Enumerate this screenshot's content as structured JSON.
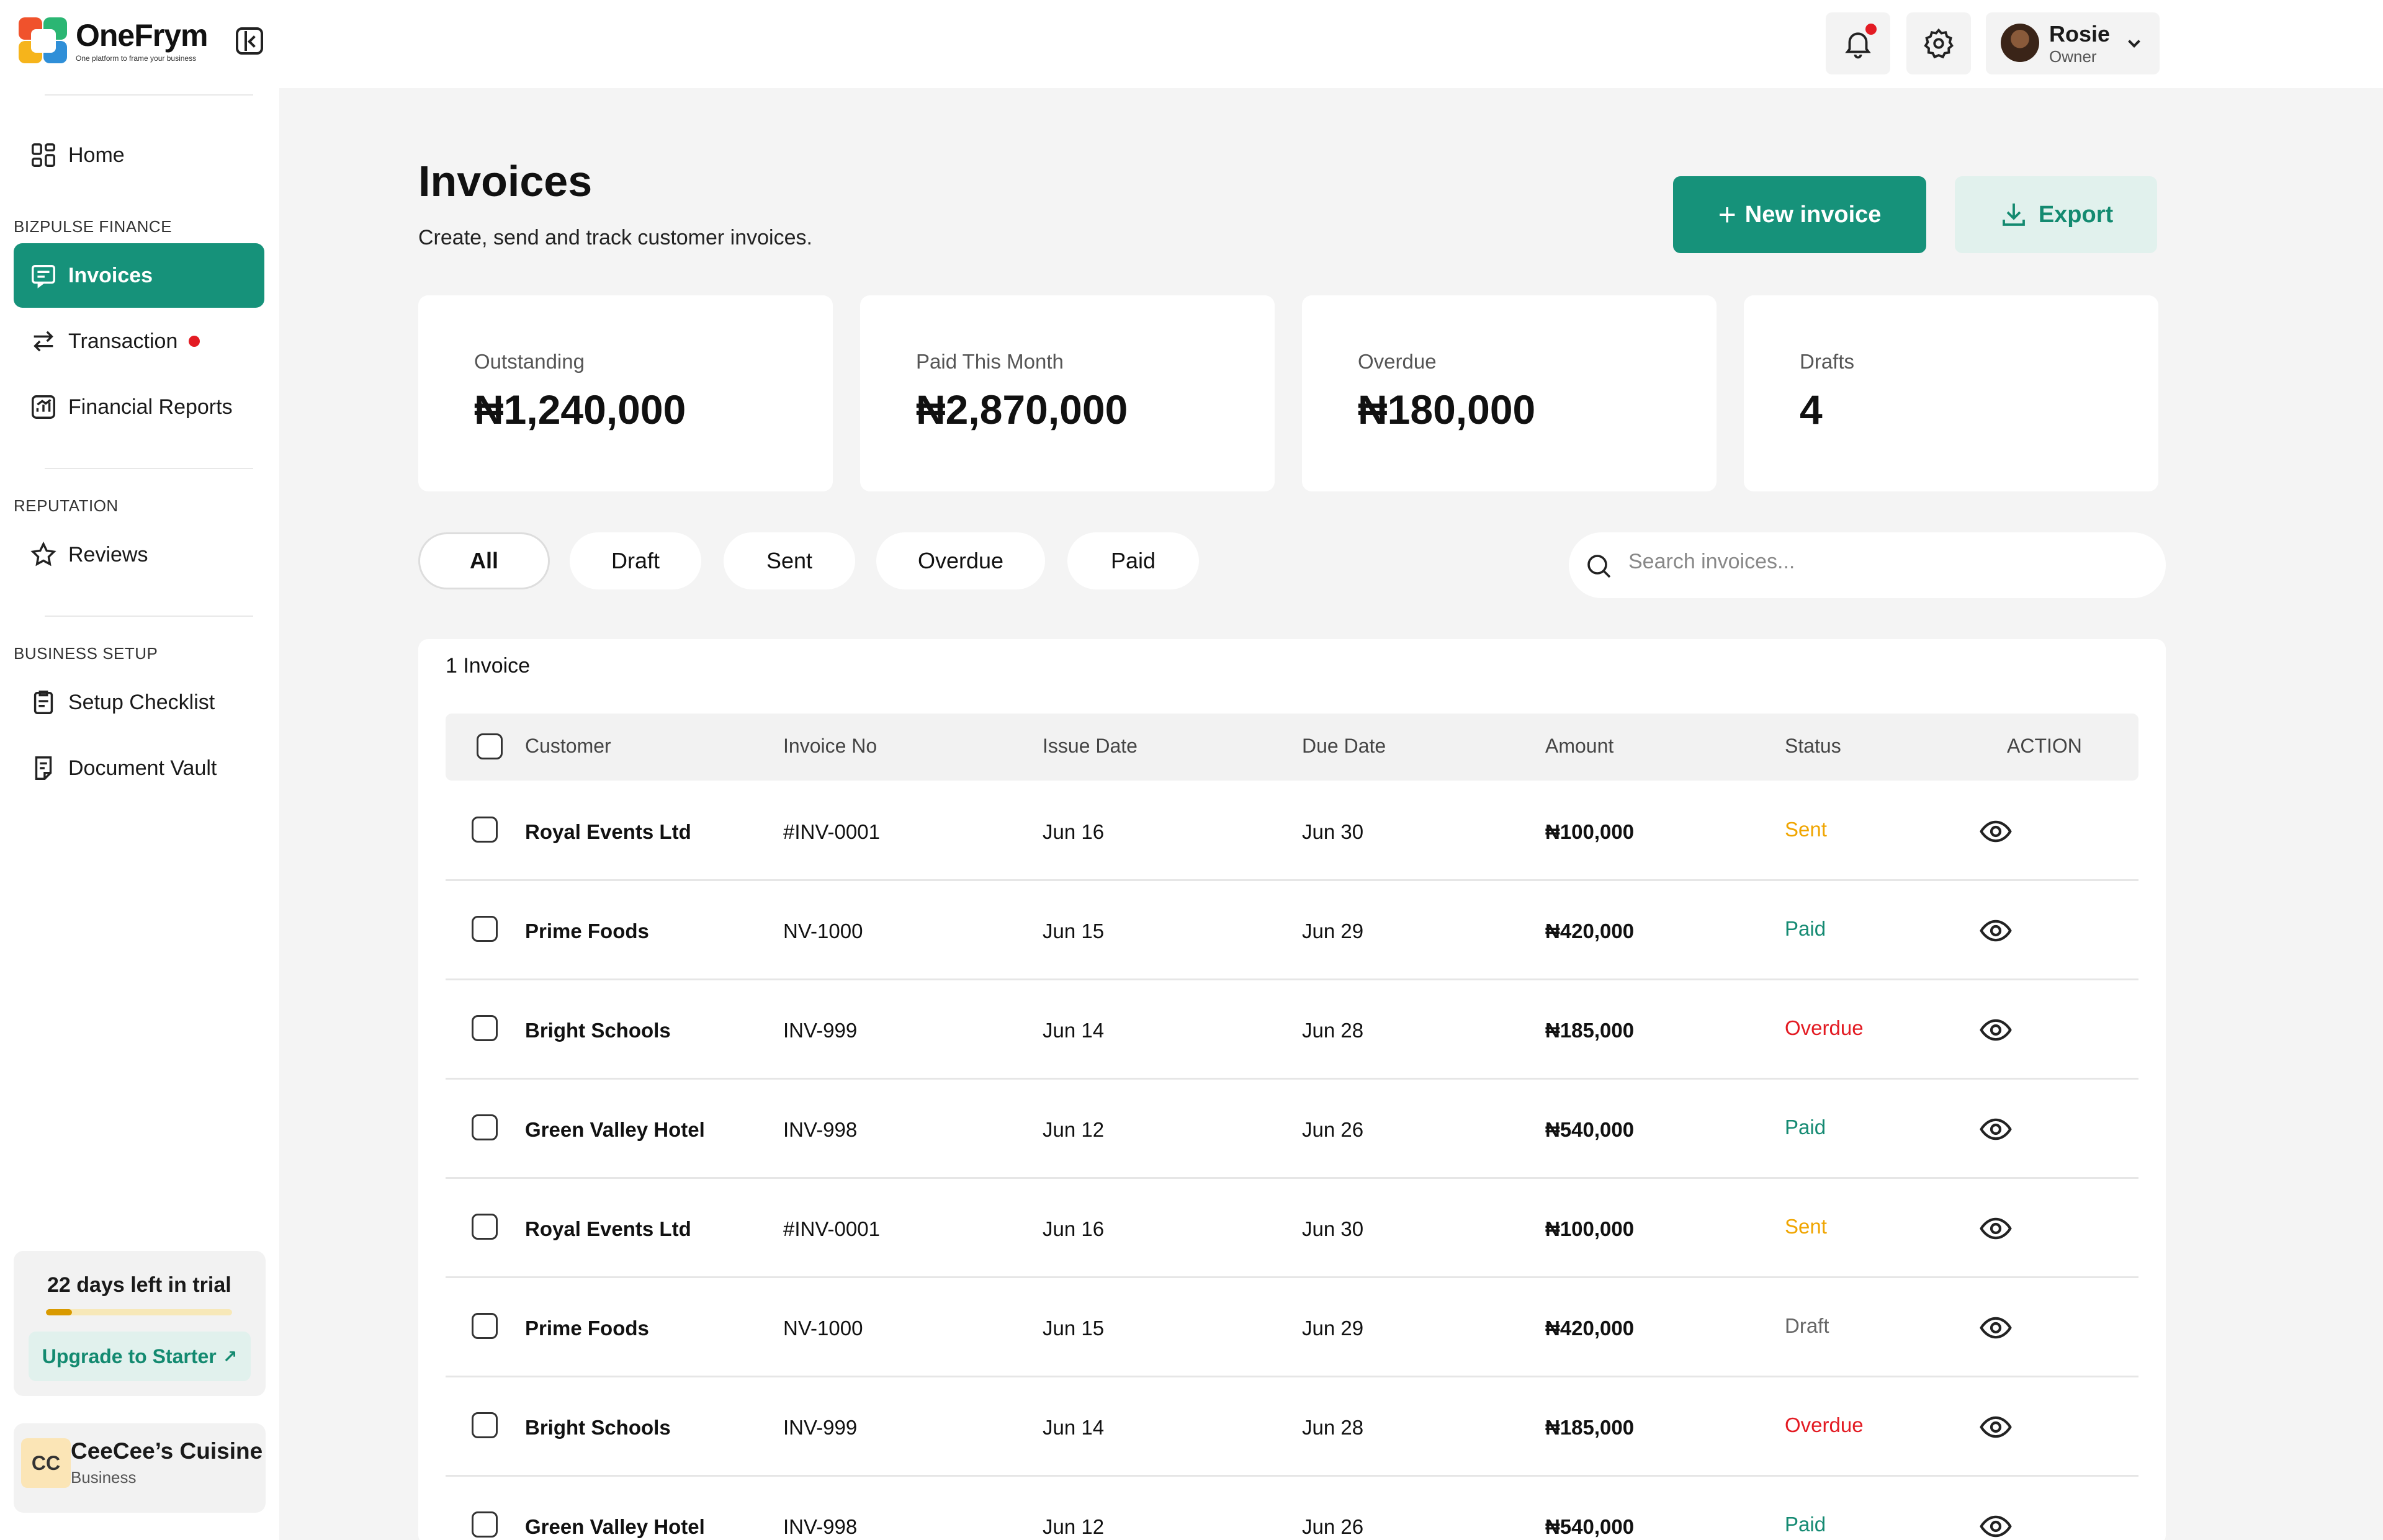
{
  "brand": {
    "name": "OneFrym",
    "tagline": "One platform to frame your business"
  },
  "sidebar": {
    "home": "Home",
    "sections": [
      {
        "label": "BIZPULSE FINANCE",
        "items": [
          "Invoices",
          "Transaction",
          "Financial Reports"
        ]
      },
      {
        "label": "REPUTATION",
        "items": [
          "Reviews"
        ]
      },
      {
        "label": "BUSINESS SETUP",
        "items": [
          "Setup Checklist",
          "Document Vault"
        ]
      }
    ],
    "trial": {
      "title": "22 days left in trial",
      "progress": 0.14,
      "upgrade": "Upgrade to Starter"
    },
    "business": {
      "initials": "CC",
      "name": "CeeCee’s Cuisine",
      "type": "Business"
    }
  },
  "user": {
    "name": "Rosie",
    "role": "Owner"
  },
  "page": {
    "title": "Invoices",
    "subtitle": "Create, send and track customer invoices.",
    "new_invoice": "New invoice",
    "export": "Export"
  },
  "stats": [
    {
      "label": "Outstanding",
      "value": "₦1,240,000"
    },
    {
      "label": "Paid This Month",
      "value": "₦2,870,000"
    },
    {
      "label": "Overdue",
      "value": "₦180,000"
    },
    {
      "label": "Drafts",
      "value": "4"
    }
  ],
  "filters": [
    "All",
    "Draft",
    "Sent",
    "Overdue",
    "Paid"
  ],
  "search": {
    "placeholder": "Search invoices..."
  },
  "table": {
    "count": "1 Invoice",
    "headers": [
      "Customer",
      "Invoice No",
      "Issue Date",
      "Due Date",
      "Amount",
      "Status",
      "ACTION"
    ],
    "rows": [
      {
        "customer": "Royal Events Ltd",
        "invoice": "#INV-0001",
        "issue": "Jun 16",
        "due": "Jun 30",
        "amount": "₦100,000",
        "status": "Sent"
      },
      {
        "customer": "Prime Foods",
        "invoice": "NV-1000",
        "issue": "Jun 15",
        "due": "Jun 29",
        "amount": "₦420,000",
        "status": "Paid"
      },
      {
        "customer": "Bright Schools",
        "invoice": "INV-999",
        "issue": "Jun 14",
        "due": "Jun 28",
        "amount": "₦185,000",
        "status": "Overdue"
      },
      {
        "customer": "Green Valley Hotel",
        "invoice": "INV-998",
        "issue": "Jun 12",
        "due": "Jun 26",
        "amount": "₦540,000",
        "status": "Paid"
      },
      {
        "customer": "Royal Events Ltd",
        "invoice": "#INV-0001",
        "issue": "Jun 16",
        "due": "Jun 30",
        "amount": "₦100,000",
        "status": "Sent"
      },
      {
        "customer": "Prime Foods",
        "invoice": "NV-1000",
        "issue": "Jun 15",
        "due": "Jun 29",
        "amount": "₦420,000",
        "status": "Draft"
      },
      {
        "customer": "Bright Schools",
        "invoice": "INV-999",
        "issue": "Jun 14",
        "due": "Jun 28",
        "amount": "₦185,000",
        "status": "Overdue"
      },
      {
        "customer": "Green Valley Hotel",
        "invoice": "INV-998",
        "issue": "Jun 12",
        "due": "Jun 26",
        "amount": "₦540,000",
        "status": "Paid"
      }
    ]
  },
  "colors": {
    "accent": "#16927a",
    "accent_soft": "#e1f1ed",
    "status": {
      "Sent": "#f0a500",
      "Paid": "#148a72",
      "Overdue": "#e31b23",
      "Draft": "#666666"
    }
  }
}
